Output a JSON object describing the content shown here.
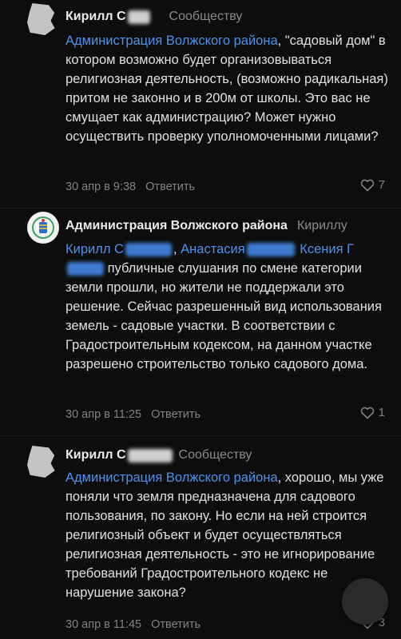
{
  "comments": [
    {
      "author": "Кирилл С",
      "recipient": "Сообществу",
      "mention": "Администрация Волжского района",
      "text_after_mention": ", \"садовый дом\" в котором возможно будет организовываться религиозная деятельность, (возможно радикальная) притом не законно и в 200м от школы. Это вас не смущает как администрацию? Может нужно осуществить проверку уполномоченными лицами?",
      "date": "30 апр в 9:38",
      "reply_label": "Ответить",
      "likes": "7"
    },
    {
      "author": "Администрация Волжского района",
      "recipient": "Кириллу",
      "mention_1": "Кирилл С",
      "separator": ",",
      "mention_2": "Анастасия",
      "mention_3": "Ксения Г",
      "text_after_mention": " публичные слушания по смене категории земли прошли, но жители не поддержали это решение. Сейчас разрешенный вид использования земель - садовые участки. В соответствии с Градостроительным кодексом, на данном участке разрешено строительство только садового дома.",
      "date": "30 апр в 11:25",
      "reply_label": "Ответить",
      "likes": "1"
    },
    {
      "author": "Кирилл С",
      "recipient": "Сообществу",
      "mention": "Администрация Волжского района",
      "text_after_mention": ", хорошо, мы уже поняли что земля предназначена для садового пользования, по закону. Но если на ней строится религиозный объект и будет осуществляться религиозная деятельность - это не игнорирование требований Градостроительного кодекс не нарушение закона?",
      "date": "30 апр в 11:45",
      "reply_label": "Ответить",
      "likes": "3"
    }
  ],
  "colors": {
    "background": "#0d0d0d",
    "link": "#4d92ea",
    "text": "#e0e0e0",
    "meta": "#828282"
  },
  "icons": {
    "like": "heart-outline-icon",
    "admin_avatar": "community-logo-icon",
    "compose": "compose-fab"
  }
}
